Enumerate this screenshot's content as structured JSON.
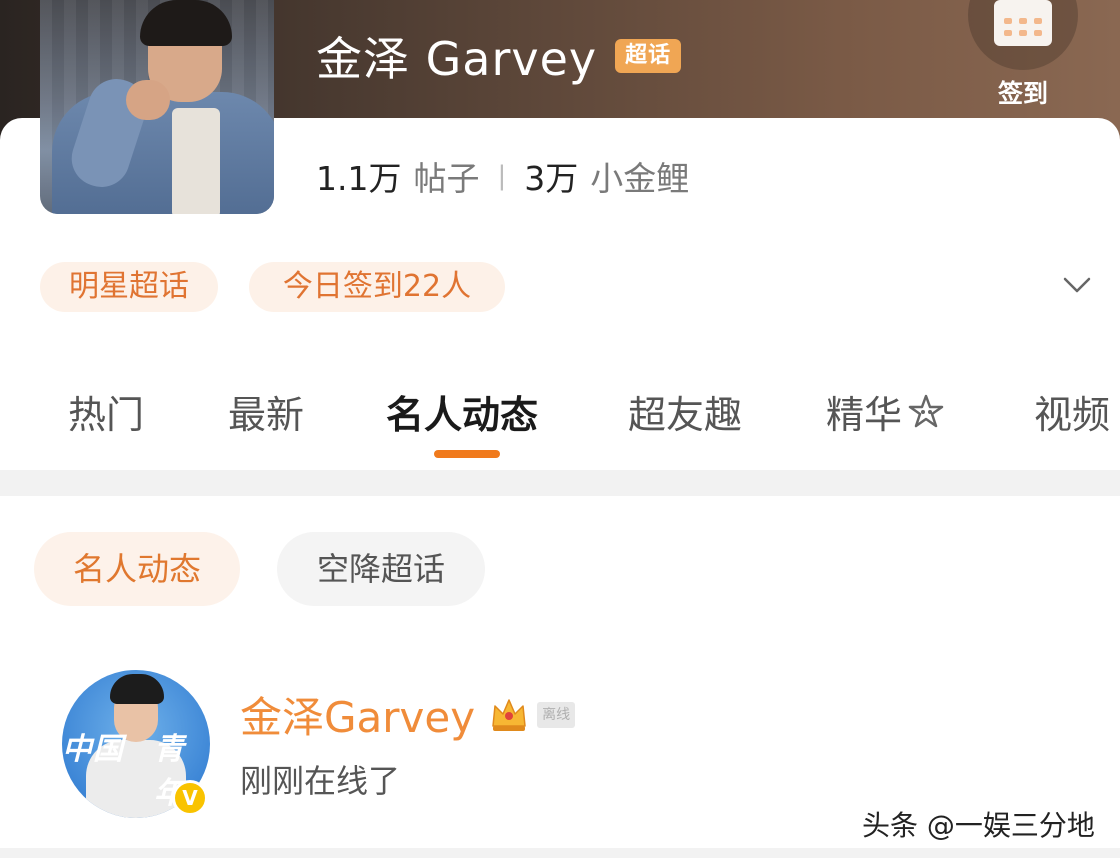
{
  "header": {
    "title": "金泽 Garvey",
    "super_tag": "超话",
    "checkin_label": "签到"
  },
  "stats": {
    "posts_num": "1.1万",
    "posts_unit": "帖子",
    "fans_num": "3万",
    "fans_unit": "小金鲤"
  },
  "pills": {
    "category": "明星超话",
    "checkin_today": "今日签到22人"
  },
  "tabs": [
    {
      "label": "热门"
    },
    {
      "label": "最新"
    },
    {
      "label": "名人动态"
    },
    {
      "label": "超友趣"
    },
    {
      "label": "精华"
    },
    {
      "label": "视频"
    }
  ],
  "subtabs": [
    {
      "label": "名人动态"
    },
    {
      "label": "空降超话"
    }
  ],
  "post": {
    "username": "金泽Garvey",
    "offline_tag": "离线",
    "status": "刚刚在线了",
    "avatar_text_left": "中国",
    "avatar_text_right": "青年",
    "verified_mark": "V"
  },
  "watermark": "头条 @一娱三分地",
  "colors": {
    "accent": "#f07a1c",
    "pill_bg": "#fdf1e8",
    "username": "#f08c3a",
    "super_tag": "#f0a654"
  }
}
